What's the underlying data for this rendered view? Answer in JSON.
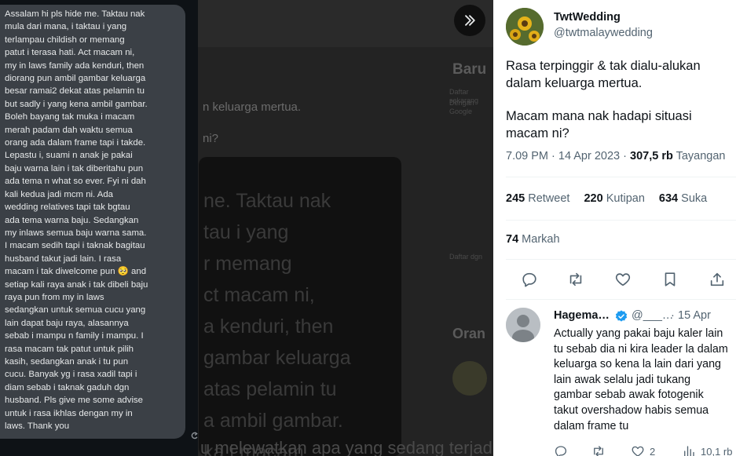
{
  "chat": {
    "message": "Assalam hi pls hide me. Taktau nak\nmula dari mana, i taktau i yang\nterlampau childish or memang\npatut i terasa hati. Act macam ni,\nmy in laws family ada kenduri, then\ndiorang pun ambil gambar keluarga\nbesar ramai2 dekat atas pelamin tu\nbut sadly i yang kena ambil gambar.\nBoleh bayang tak muka i macam\nmerah padam dah waktu semua\norang ada dalam frame tapi i takde.\nLepastu i, suami n anak je pakai\nbaju warna lain i tak diberitahu pun\nada tema n what so ever. Fyi ni dah\nkali kedua jadi mcm ni. Ada\nwedding relatives tapi tak bgtau\nada tema warna baju. Sedangkan\nmy inlaws semua baju warna sama.\nI macam sedih tapi i taknak bagitau\nhusband takut jadi lain. I rasa\nmacam i tak diwelcome pun 🥺 and\nsetiap kali raya anak i tak dibeli baju\nraya pun from my in laws\nsedangkan untuk semua cucu yang\nlain dapat baju raya, alasannya\nsebab i mampu n family i mampu. I\nrasa macam tak patut untuk pilih\nkasih, sedangkan anak i tu pun\ncucu. Banyak yg i rasa xadil tapi i\ndiam sebab i taknak gaduh dgn\nhusband. Pls give me some advise\nuntuk i rasa ikhlas dengan my in\nlaws. Thank you"
  },
  "background": {
    "blurred_line": "n keluarga mertua.",
    "blurred_q": "ni?",
    "card_text": "ne. Taktau nak\ntau i yang\nr memang\nct macam ni,\na kenduri, then\ngambar keluarga\natas pelamin tu\na ambil gambar.\nka i macam",
    "right_title": "Baru",
    "right_small_1": "Daftar sekarang",
    "right_small_2": "Dengan Google",
    "right_small_3": "Daftar dgn",
    "right_orang": "Oran",
    "bottom_text": "u melewatkan apa yang sedang terjadi"
  },
  "tweet": {
    "author_name": "TwtWedding",
    "author_handle": "@twtmalaywedding",
    "paragraph_1": "Rasa terpinggir & tak dialu-alukan dalam keluarga mertua.",
    "paragraph_2": "Macam mana nak hadapi situasi macam ni?",
    "time": "7.09 PM",
    "date": "14 Apr 2023",
    "views_count": "307,5 rb",
    "views_label": "Tayangan",
    "retweets_count": "245",
    "retweets_label": "Retweet",
    "quotes_count": "220",
    "quotes_label": "Kutipan",
    "likes_count": "634",
    "likes_label": "Suka",
    "bookmarks_count": "74",
    "bookmarks_label": "Markah"
  },
  "reply": {
    "author_name": "Hagema…",
    "author_handle": "@___…",
    "date": "15 Apr",
    "text": "Actually yang pakai baju kaler lain\ntu sebab dia ni kira leader la dalam\nkeluarga so kena la lain dari yang\nlain awak selalu jadi tukang\ngambar sebab awak fotogenik\ntakut overshadow habis semua\ndalam frame tu",
    "likes_count": "2",
    "views_count": "10,1 rb"
  },
  "icons": {
    "expand": "chevrons-right-icon",
    "reply": "reply-icon",
    "retweet": "retweet-icon",
    "like": "heart-icon",
    "bookmark": "bookmark-icon",
    "share": "share-icon",
    "verified": "verified-badge-icon"
  },
  "colors": {
    "accent": "#1d9bf0",
    "text_primary": "#0f1419",
    "text_secondary": "#536471",
    "chat_bubble": "#3b4046"
  }
}
